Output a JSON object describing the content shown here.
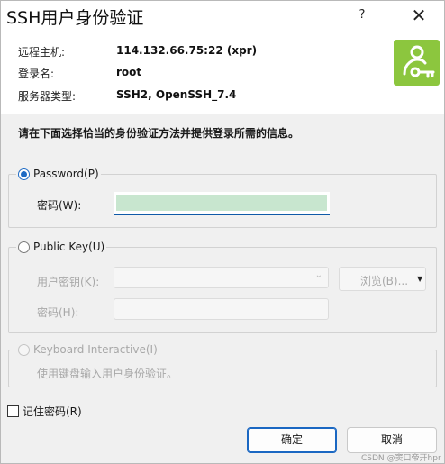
{
  "title": "SSH用户身份验证",
  "titlebar": {
    "help_label": "?",
    "close_label": "✕"
  },
  "info": {
    "rows": [
      {
        "label": "远程主机:",
        "value": "114.132.66.75:22 (xpr)"
      },
      {
        "label": "登录名:",
        "value": "root"
      },
      {
        "label": "服务器类型:",
        "value": "SSH2, OpenSSH_7.4"
      }
    ],
    "logo_icon": "user-key-icon",
    "logo_color": "#8cc63e"
  },
  "instruction": "请在下面选择恰当的身份验证方法并提供登录所需的信息。",
  "password_group": {
    "radio_label": "Password(P)",
    "selected": true,
    "field_label": "密码(W):",
    "field_value": ""
  },
  "publickey_group": {
    "radio_label": "Public Key(U)",
    "selected": false,
    "key_label": "用户密钥(K):",
    "passphrase_label": "密码(H):",
    "browse_label": "浏览(B)..."
  },
  "keyboard_group": {
    "radio_label": "Keyboard Interactive(I)",
    "selected": false,
    "description": "使用键盘输入用户身份验证。"
  },
  "remember_password": {
    "label": "记住密码(R)",
    "checked": false
  },
  "buttons": {
    "ok": "确定",
    "cancel": "取消"
  },
  "watermark": "CSDN @窦口帝开hpr",
  "colors": {
    "accent": "#1a67c2",
    "password_fill": "#c8e6cf",
    "background": "#f0f0f0"
  }
}
